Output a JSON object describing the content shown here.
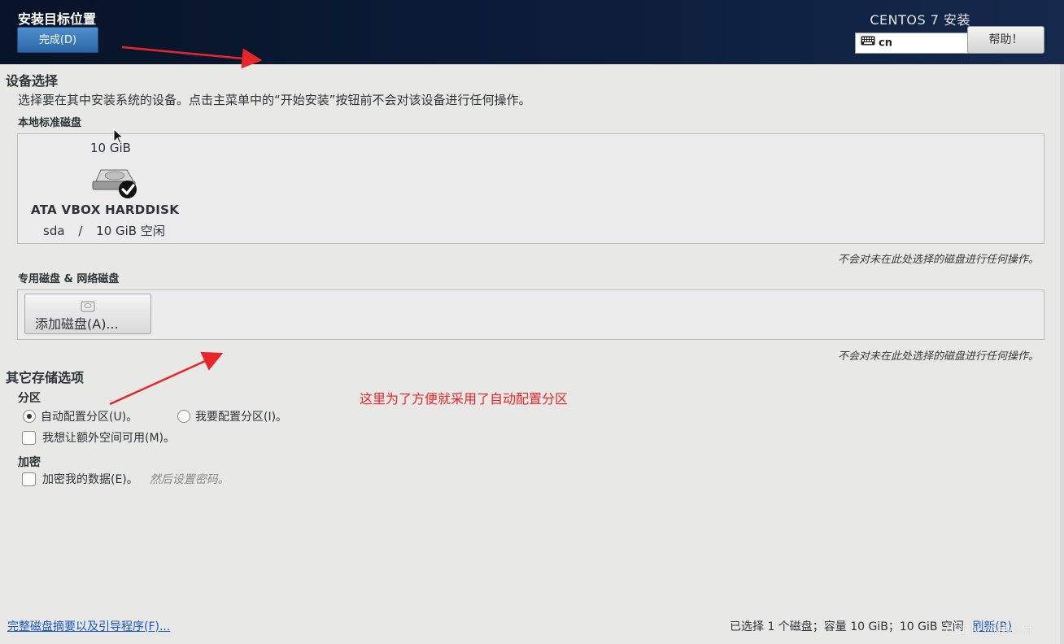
{
  "header": {
    "title": "安装目标位置",
    "done_button": "完成(D)",
    "product": "CENTOS 7 安装",
    "keyboard_layout": "cn",
    "help_button": "帮助！"
  },
  "device_selection": {
    "title": "设备选择",
    "description": "选择要在其中安装系统的设备。点击主菜单中的“开始安装”按钮前不会对该设备进行任何操作。",
    "local_disks_label": "本地标准磁盘",
    "disk": {
      "size": "10 GiB",
      "name": "ATA VBOX HARDDISK",
      "device": "sda",
      "separator": "/",
      "free": "10 GiB 空闲",
      "selected": true
    },
    "local_note": "不会对未在此处选择的磁盘进行任何操作。",
    "special_disks_label": "专用磁盘 & 网络磁盘",
    "add_disk_button": "添加磁盘(A)...",
    "special_note": "不会对未在此处选择的磁盘进行任何操作。"
  },
  "other_storage": {
    "title": "其它存储选项",
    "partition_label": "分区",
    "auto_partition": "自动配置分区(U)。",
    "manual_partition": "我要配置分区(I)。",
    "selected_partition": "auto",
    "extra_space": "我想让额外空间可用(M)。",
    "extra_space_checked": false,
    "encryption_label": "加密",
    "encrypt_data": "加密我的数据(E)。",
    "encrypt_checked": false,
    "encrypt_hint": "然后设置密码。"
  },
  "annotation": "这里为了方便就采用了自动配置分区",
  "footer": {
    "summary_link": "完整磁盘摘要以及引导程序(F)...",
    "status": "已选择 1 个磁盘；容量 10 GiB；10 GiB 空闲",
    "refresh": "刷新(R)"
  },
  "watermark": "CSDN @猿小付",
  "colors": {
    "header_bg": "#0c1d3a",
    "done_button": "#3b7bbd",
    "annotation_red": "#e8262a",
    "link_blue": "#1a56c9",
    "content_bg": "#e8e8e7"
  }
}
